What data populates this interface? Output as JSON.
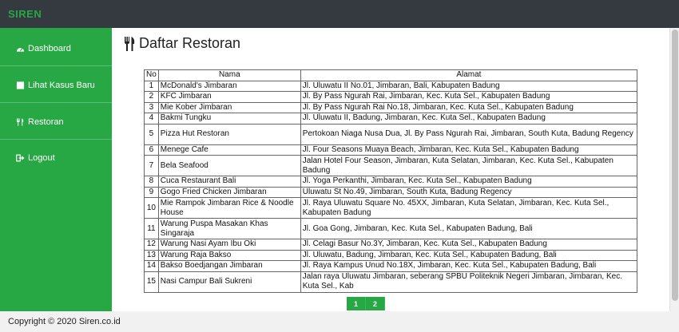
{
  "brand": "SIREN",
  "sidebar": {
    "items": [
      {
        "label": "Dashboard",
        "icon": "dashboard-icon"
      },
      {
        "label": "Lihat Kasus Baru",
        "icon": "square-icon"
      },
      {
        "label": "Restoran",
        "icon": "utensils-icon"
      },
      {
        "label": "Logout",
        "icon": "sign-out-icon"
      }
    ]
  },
  "page": {
    "title": "Daftar Restoran",
    "title_icon": "utensils-icon"
  },
  "table": {
    "headers": [
      "No",
      "Nama",
      "Alamat"
    ],
    "rows": [
      {
        "no": "1",
        "nama": "McDonald's Jimbaran",
        "alamat": "Jl. Uluwatu II No.01, Jimbaran, Bali, Kabupaten Badung"
      },
      {
        "no": "2",
        "nama": "KFC Jimbaran",
        "alamat": "Jl. By Pass Ngurah Rai, Jimbaran, Kec. Kuta Sel., Kabupaten Badung"
      },
      {
        "no": "3",
        "nama": "Mie Kober Jimbaran",
        "alamat": "Jl. By Pass Ngurah Rai No.18, Jimbaran, Kec. Kuta Sel., Kabupaten Badung"
      },
      {
        "no": "4",
        "nama": "Bakmi Tungku",
        "alamat": "Jl. Uluwatu II, Badung, Jimbaran, Kec. Kuta Sel., Kabupaten Badung"
      },
      {
        "no": "5",
        "nama": "Pizza Hut Restoran",
        "alamat": "Pertokoan Niaga Nusa Dua, Jl. By Pass Ngurah Rai, Jimbaran, South Kuta, Badung Regency"
      },
      {
        "no": "6",
        "nama": "Menege Cafe",
        "alamat": "Jl. Four Seasons Muaya Beach, Jimbaran, Kec. Kuta Sel., Kabupaten Badung"
      },
      {
        "no": "7",
        "nama": "Bela Seafood",
        "alamat": "Jalan Hotel Four Season, Jimbaran, Kuta Selatan, Jimbaran, Kec. Kuta Sel., Kabupaten Badung"
      },
      {
        "no": "8",
        "nama": "Cuca Restaurant Bali",
        "alamat": "Jl. Yoga Perkanthi, Jimbaran, Kec. Kuta Sel., Kabupaten Badung"
      },
      {
        "no": "9",
        "nama": "Gogo Fried Chicken Jimbaran",
        "alamat": "Uluwatu St No.49, Jimbaran, South Kuta, Badung Regency"
      },
      {
        "no": "10",
        "nama": "Mie Rampok Jimbaran Rice & Noodle House",
        "alamat": "Jl. Raya Uluwatu Square No. 45XX, Jimbaran, Kuta Selatan, Jimbaran, Kec. Kuta Sel., Kabupaten Badung"
      },
      {
        "no": "11",
        "nama": "Warung Puspa Masakan Khas Singaraja",
        "alamat": "Jl. Goa Gong, Jimbaran, Kec. Kuta Sel., Kabupaten Badung, Bali"
      },
      {
        "no": "12",
        "nama": "Warung Nasi Ayam Ibu Oki",
        "alamat": "Jl. Celagi Basur No.3Y, Jimbaran, Kec. Kuta Sel., Kabupaten Badung"
      },
      {
        "no": "13",
        "nama": "Warung Raja Bakso",
        "alamat": "Jl. Uluwatu, Badung, Jimbaran, Kec. Kuta Sel., Kabupaten Badung, Bali"
      },
      {
        "no": "14",
        "nama": "Bakso Boedjangan Jimbaran",
        "alamat": "Jl. Raya Kampus Unud No.18X, Jimbaran, Kec. Kuta Sel., Kabupaten Badung, Bali"
      },
      {
        "no": "15",
        "nama": "Nasi Campur Bali Sukreni",
        "alamat": "Jalan raya Uluwatu Jimbaran, seberang SPBU Politeknik Negeri Jimbaran, Jimbaran, Kec. Kuta Sel., Kab"
      }
    ]
  },
  "pagination": [
    "1",
    "2"
  ],
  "footer": {
    "text": "Copyright © 2020 Siren.co.id"
  },
  "colors": {
    "accent": "#28a745",
    "topbar": "#343a40"
  }
}
